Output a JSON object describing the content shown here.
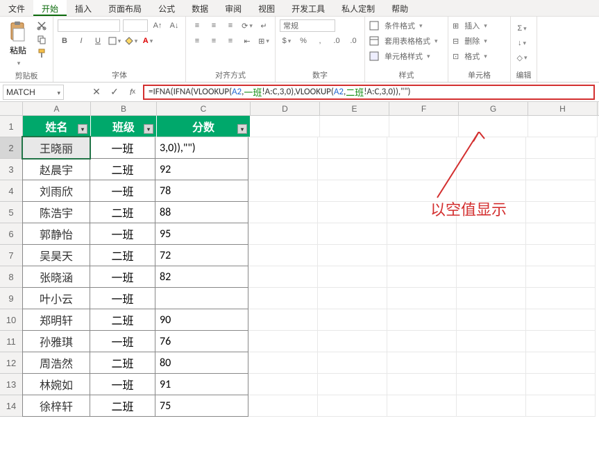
{
  "ribbon": {
    "tabs": [
      "文件",
      "开始",
      "插入",
      "页面布局",
      "公式",
      "数据",
      "审阅",
      "视图",
      "开发工具",
      "私人定制",
      "帮助"
    ],
    "active_tab": "开始",
    "groups": {
      "clipboard": {
        "label": "剪贴板",
        "paste": "粘贴"
      },
      "font": {
        "label": "字体",
        "bold": "B",
        "italic": "I",
        "underline": "U"
      },
      "align": {
        "label": "对齐方式"
      },
      "number": {
        "label": "数字",
        "format": "常规"
      },
      "styles": {
        "label": "样式",
        "cond": "条件格式",
        "tbl": "套用表格格式",
        "cell": "单元格样式"
      },
      "cells": {
        "label": "单元格",
        "insert": "插入",
        "delete": "删除",
        "format": "格式"
      },
      "editing": {
        "label": "编辑"
      }
    }
  },
  "name_box": "MATCH",
  "formula": {
    "prefix": "=IFNA(IFNA(VLOOKUP(",
    "ref1": "A2",
    "mid1": ",",
    "sheet1": "一班",
    "mid2": "!A:C,3,0),VLOOKUP(",
    "ref2": "A2",
    "mid3": ",",
    "sheet2": "二班",
    "mid4": "!A:C,3,0)),\"\")"
  },
  "columns": [
    "A",
    "B",
    "C",
    "D",
    "E",
    "F",
    "G",
    "H"
  ],
  "headers": {
    "A": "姓名",
    "B": "班级",
    "C": "分数"
  },
  "rows": [
    {
      "n": "1"
    },
    {
      "n": "2",
      "A": "王晓丽",
      "B": "一班",
      "C": "3,0)),\"\")",
      "sel": true
    },
    {
      "n": "3",
      "A": "赵晨宇",
      "B": "二班",
      "C": "92"
    },
    {
      "n": "4",
      "A": "刘雨欣",
      "B": "一班",
      "C": "78"
    },
    {
      "n": "5",
      "A": "陈浩宇",
      "B": "二班",
      "C": "88"
    },
    {
      "n": "6",
      "A": "郭静怡",
      "B": "一班",
      "C": "95"
    },
    {
      "n": "7",
      "A": "吴昊天",
      "B": "二班",
      "C": "72"
    },
    {
      "n": "8",
      "A": "张晓涵",
      "B": "一班",
      "C": "82"
    },
    {
      "n": "9",
      "A": "叶小云",
      "B": "一班",
      "C": ""
    },
    {
      "n": "10",
      "A": "郑明轩",
      "B": "二班",
      "C": "90"
    },
    {
      "n": "11",
      "A": "孙雅琪",
      "B": "一班",
      "C": "76"
    },
    {
      "n": "12",
      "A": "周浩然",
      "B": "二班",
      "C": "80"
    },
    {
      "n": "13",
      "A": "林婉如",
      "B": "一班",
      "C": "91"
    },
    {
      "n": "14",
      "A": "徐梓轩",
      "B": "二班",
      "C": "75"
    }
  ],
  "annotation": "以空值显示"
}
